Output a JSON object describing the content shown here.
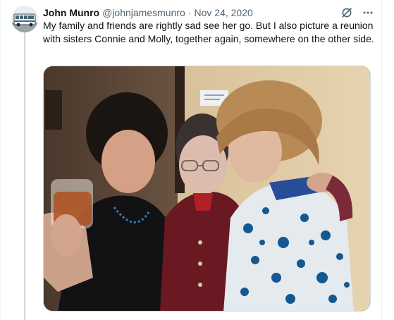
{
  "tweet": {
    "author_name": "John Munro",
    "author_handle": "@johnjamesmunro",
    "separator": "·",
    "date": "Nov 24, 2020",
    "text": "My family and friends are rightly sad see her go. But I also picture a reunion with sisters Connie and Molly, together again, somewhere on the other side."
  },
  "icons": {
    "grok": "grok-icon",
    "more": "more-options-icon",
    "avatar": "bus-avatar"
  },
  "colors": {
    "text": "#0f1419",
    "secondary": "#536471",
    "border": "#cfd9de"
  }
}
